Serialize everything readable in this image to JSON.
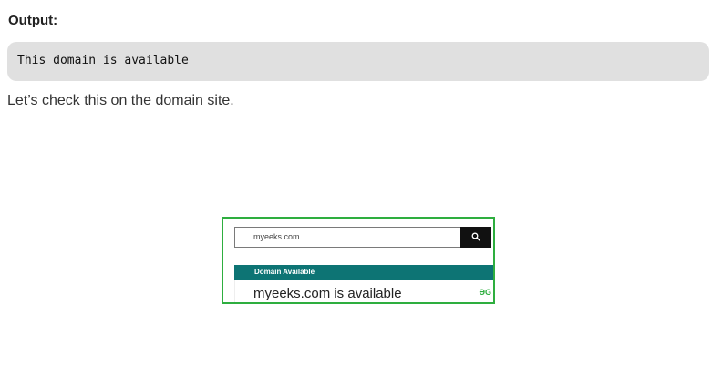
{
  "output_label": "Output:",
  "code_output": "This domain is available",
  "paragraph": "Let’s check this on the domain site.",
  "figure": {
    "search": {
      "value": "myeeks.com",
      "button_icon": "search-icon"
    },
    "banner_label": "Domain Available",
    "result_text": "myeeks.com is available",
    "brand_mark": "ƏG"
  },
  "colors": {
    "code_bg": "#e0e0e0",
    "figure_border": "#2eae3f",
    "banner": "#0d7474",
    "search_button": "#111111"
  }
}
